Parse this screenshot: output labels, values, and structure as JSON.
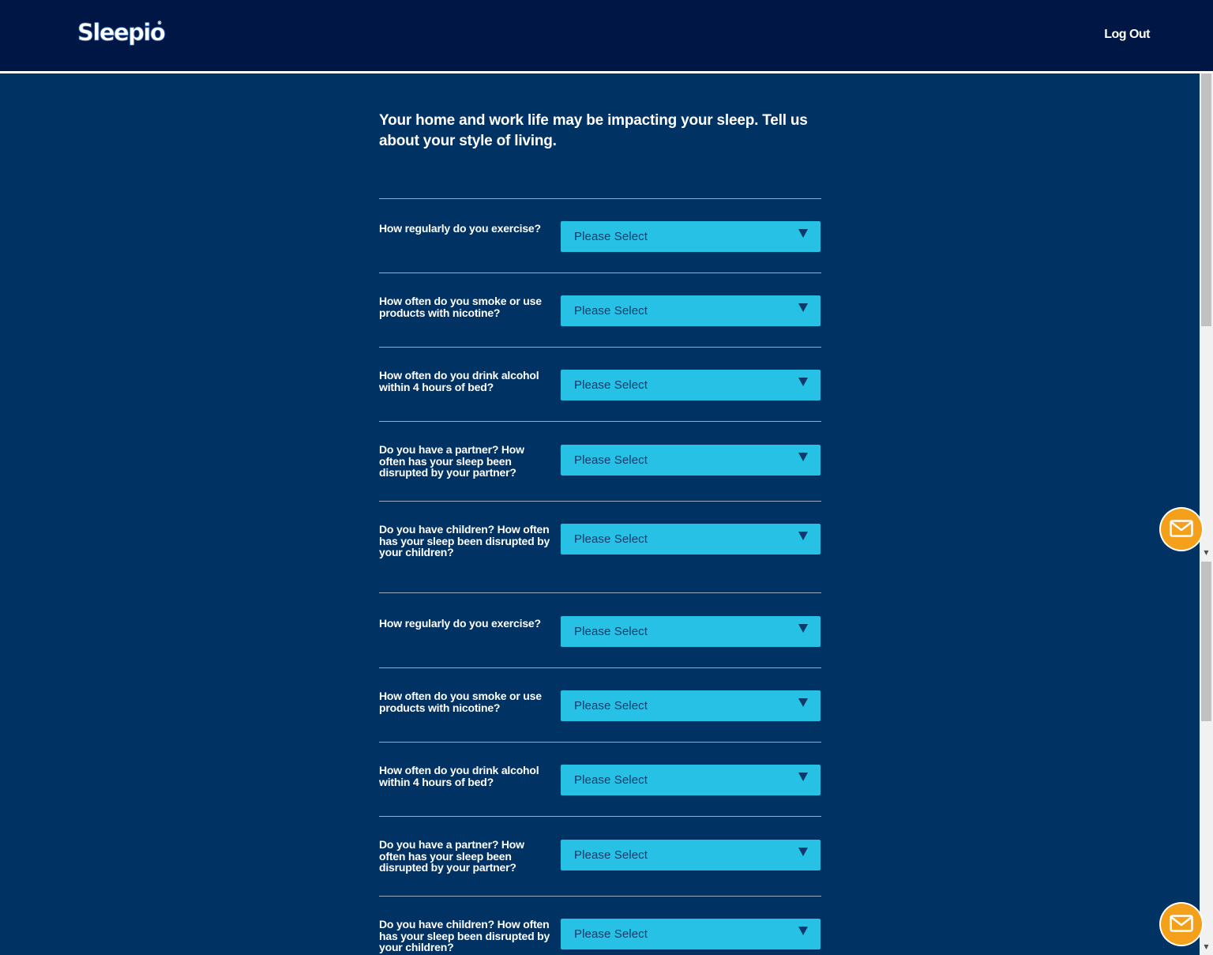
{
  "header": {
    "logo_text": "Sleepio",
    "logo_tm": "®",
    "logout_label": "Log Out"
  },
  "main": {
    "intro": "Your home and work life may be impacting your sleep. Tell us about your style of living.",
    "questions": [
      {
        "label": "How regularly do you exercise?",
        "value": "Please Select"
      },
      {
        "label": "How often do you smoke or use products with nicotine?",
        "value": "Please Select"
      },
      {
        "label": "How often do you drink alcohol within 4 hours of bed?",
        "value": "Please Select"
      },
      {
        "label": "Do you have a partner? How often has your sleep been disrupted by your partner?",
        "value": "Please Select"
      },
      {
        "label": "Do you have children? How often has your sleep been disrupted by your children?",
        "value": "Please Select"
      },
      {
        "label": "How regularly do you exercise?",
        "value": "Please Select"
      },
      {
        "label": "How often do you smoke or use products with nicotine?",
        "value": "Please Select"
      },
      {
        "label": "How often do you drink alcohol within 4 hours of bed?",
        "value": "Please Select"
      },
      {
        "label": "Do you have a partner? How often has your sleep been disrupted by your partner?",
        "value": "Please Select"
      },
      {
        "label": "Do you have children? How often has your sleep been disrupted by your children?",
        "value": "Please Select"
      }
    ]
  },
  "contact_buttons": [
    {
      "icon": "mail-icon"
    },
    {
      "icon": "mail-icon"
    }
  ],
  "colors": {
    "header_bg": "#001745",
    "page_bg": "#003263",
    "select_bg": "#28c1e6",
    "select_text": "#0e3a6b",
    "mail_button": "#f5a01a"
  }
}
